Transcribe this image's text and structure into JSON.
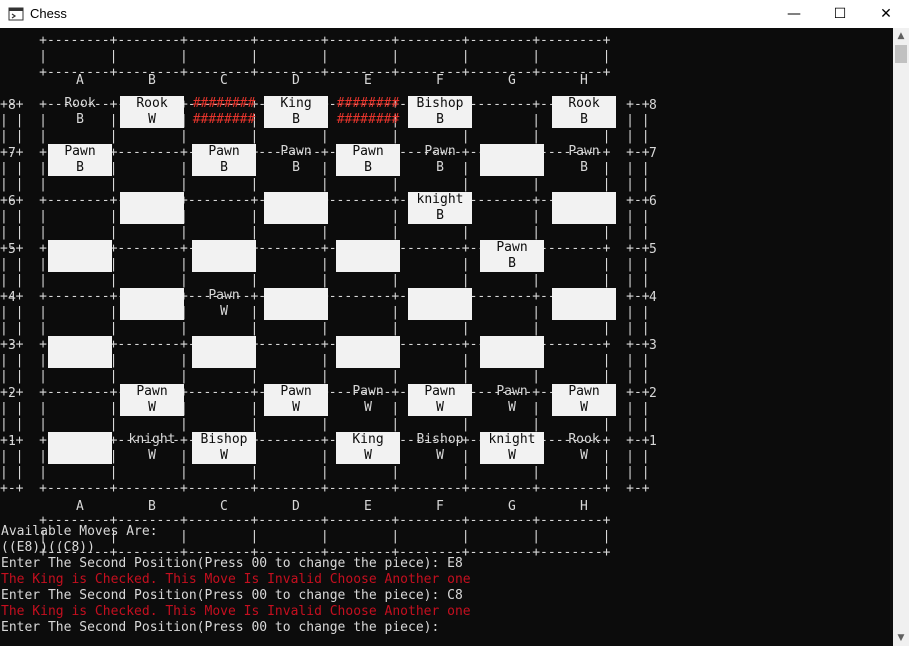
{
  "window": {
    "title": "Chess",
    "buttons": {
      "minimize": "—",
      "maximize": "☐",
      "close": "✕"
    }
  },
  "board": {
    "columns": [
      "A",
      "B",
      "C",
      "D",
      "E",
      "F",
      "G",
      "H"
    ],
    "rows": [
      "8",
      "7",
      "6",
      "5",
      "4",
      "3",
      "2",
      "1"
    ],
    "squares": [
      [
        [
          "light",
          ""
        ],
        [
          "dark",
          "Rook\nB"
        ],
        [
          "light",
          "Rook\nW"
        ],
        [
          "hatch",
          "########\n########"
        ],
        [
          "light",
          "King\nB"
        ],
        [
          "hatch",
          "########\n########"
        ],
        [
          "light",
          "Bishop\nB"
        ],
        [
          "dark",
          ""
        ],
        [
          "light",
          "Rook\nB"
        ]
      ],
      [
        [
          "light",
          ""
        ],
        [
          "light",
          "Pawn\nB"
        ],
        [
          "dark",
          ""
        ],
        [
          "light",
          "Pawn\nB"
        ],
        [
          "dark",
          "Pawn\nB"
        ],
        [
          "light",
          "Pawn\nB"
        ],
        [
          "dark",
          "Pawn\nB"
        ],
        [
          "light",
          ""
        ],
        [
          "dark",
          "Pawn\nB"
        ]
      ]
    ],
    "grid": [
      [
        {
          "c": "dark",
          "t": "Rook\nB"
        },
        {
          "c": "light",
          "t": "Rook\nW"
        },
        {
          "c": "hatch",
          "t": "########\n########"
        },
        {
          "c": "light",
          "t": "King\nB"
        },
        {
          "c": "hatch",
          "t": "########\n########"
        },
        {
          "c": "light",
          "t": "Bishop\nB"
        },
        {
          "c": "dark",
          "t": ""
        },
        {
          "c": "light",
          "t": "Rook\nB"
        }
      ],
      [
        {
          "c": "light",
          "t": "Pawn\nB"
        },
        {
          "c": "dark",
          "t": ""
        },
        {
          "c": "light",
          "t": "Pawn\nB"
        },
        {
          "c": "dark",
          "t": "Pawn\nB"
        },
        {
          "c": "light",
          "t": "Pawn\nB"
        },
        {
          "c": "dark",
          "t": "Pawn\nB"
        },
        {
          "c": "light",
          "t": ""
        },
        {
          "c": "dark",
          "t": "Pawn\nB"
        }
      ],
      [
        {
          "c": "dark",
          "t": ""
        },
        {
          "c": "light",
          "t": ""
        },
        {
          "c": "dark",
          "t": ""
        },
        {
          "c": "light",
          "t": ""
        },
        {
          "c": "dark",
          "t": ""
        },
        {
          "c": "light",
          "t": "knight\nB"
        },
        {
          "c": "dark",
          "t": ""
        },
        {
          "c": "light",
          "t": ""
        }
      ],
      [
        {
          "c": "light",
          "t": ""
        },
        {
          "c": "dark",
          "t": ""
        },
        {
          "c": "light",
          "t": ""
        },
        {
          "c": "dark",
          "t": ""
        },
        {
          "c": "light",
          "t": ""
        },
        {
          "c": "dark",
          "t": ""
        },
        {
          "c": "light",
          "t": "Pawn\nB"
        },
        {
          "c": "dark",
          "t": ""
        }
      ],
      [
        {
          "c": "dark",
          "t": ""
        },
        {
          "c": "light",
          "t": ""
        },
        {
          "c": "dark",
          "t": "Pawn\nW"
        },
        {
          "c": "light",
          "t": ""
        },
        {
          "c": "dark",
          "t": ""
        },
        {
          "c": "light",
          "t": ""
        },
        {
          "c": "dark",
          "t": ""
        },
        {
          "c": "light",
          "t": ""
        }
      ],
      [
        {
          "c": "light",
          "t": ""
        },
        {
          "c": "dark",
          "t": ""
        },
        {
          "c": "light",
          "t": ""
        },
        {
          "c": "dark",
          "t": ""
        },
        {
          "c": "light",
          "t": ""
        },
        {
          "c": "dark",
          "t": ""
        },
        {
          "c": "light",
          "t": ""
        },
        {
          "c": "dark",
          "t": ""
        }
      ],
      [
        {
          "c": "dark",
          "t": ""
        },
        {
          "c": "light",
          "t": "Pawn\nW"
        },
        {
          "c": "dark",
          "t": ""
        },
        {
          "c": "light",
          "t": "Pawn\nW"
        },
        {
          "c": "dark",
          "t": "Pawn\nW"
        },
        {
          "c": "light",
          "t": "Pawn\nW"
        },
        {
          "c": "dark",
          "t": "Pawn\nW"
        },
        {
          "c": "light",
          "t": "Pawn\nW"
        }
      ],
      [
        {
          "c": "light",
          "t": ""
        },
        {
          "c": "dark",
          "t": "knight\nW"
        },
        {
          "c": "light",
          "t": "Bishop\nW"
        },
        {
          "c": "dark",
          "t": ""
        },
        {
          "c": "light",
          "t": "King\nW"
        },
        {
          "c": "dark",
          "t": "Bishop\nW"
        },
        {
          "c": "light",
          "t": "knight\nW"
        },
        {
          "c": "dark",
          "t": "Rook\nW"
        }
      ]
    ]
  },
  "output": [
    {
      "text": "Available Moves Are:",
      "color": "white"
    },
    {
      "text": "((E8))((C8))",
      "color": "white"
    },
    {
      "text": "Enter The Second Position(Press 00 to change the piece): E8",
      "color": "white"
    },
    {
      "text": "The King is Checked. This Move Is Invalid Choose Another one",
      "color": "red"
    },
    {
      "text": "Enter The Second Position(Press 00 to change the piece): C8",
      "color": "white"
    },
    {
      "text": "The King is Checked. This Move Is Invalid Choose Another one",
      "color": "red"
    },
    {
      "text": "Enter The Second Position(Press 00 to change the piece):",
      "color": "white"
    }
  ],
  "colors": {
    "background": "#0c0c0c",
    "light_square": "#f2f2f2",
    "red_text": "#c50f1f",
    "hatch": "#e6342c"
  }
}
